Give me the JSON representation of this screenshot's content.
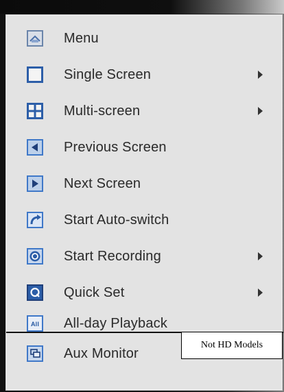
{
  "menu": {
    "items": [
      {
        "label": "Menu",
        "icon": "menu-icon",
        "has_submenu": false
      },
      {
        "label": "Single Screen",
        "icon": "single-screen-icon",
        "has_submenu": true
      },
      {
        "label": "Multi-screen",
        "icon": "multi-screen-icon",
        "has_submenu": true
      },
      {
        "label": "Previous Screen",
        "icon": "previous-screen-icon",
        "has_submenu": false
      },
      {
        "label": "Next Screen",
        "icon": "next-screen-icon",
        "has_submenu": false
      },
      {
        "label": "Start Auto-switch",
        "icon": "auto-switch-icon",
        "has_submenu": false
      },
      {
        "label": "Start Recording",
        "icon": "recording-icon",
        "has_submenu": true
      },
      {
        "label": "Quick Set",
        "icon": "quick-set-icon",
        "has_submenu": true
      },
      {
        "label": "All-day Playback",
        "icon": "all-day-playback-icon",
        "has_submenu": false
      },
      {
        "label": "Aux Monitor",
        "icon": "aux-monitor-icon",
        "has_submenu": false
      }
    ]
  },
  "note": {
    "text": "Not HD Models"
  },
  "colors": {
    "menu_bg": "#e3e3e3",
    "text": "#2f2f2f",
    "icon_blue": "#3f78c8",
    "icon_dark_blue": "#1f3f7a"
  }
}
